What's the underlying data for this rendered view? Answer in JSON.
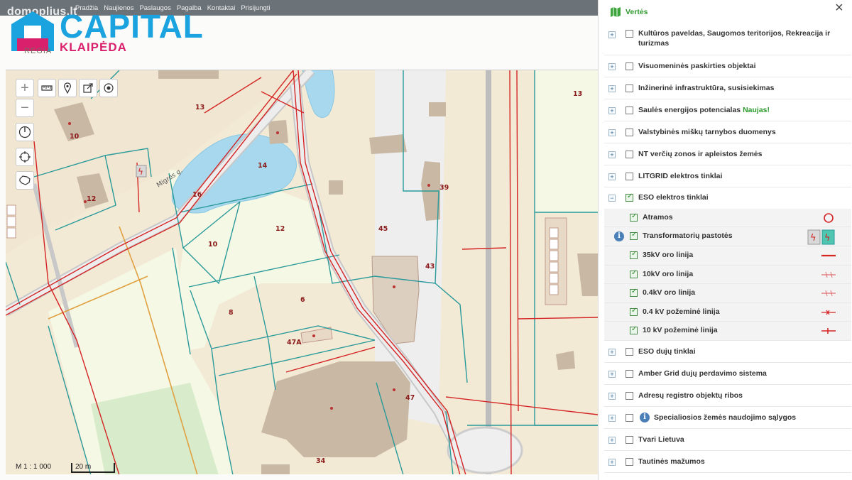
{
  "topnav": {
    "watermark": "domoplius.lt",
    "items": [
      "Pradžia",
      "Naujienos",
      "Paslaugos",
      "Pagalba",
      "Kontaktai",
      "Prisijungti"
    ]
  },
  "logo": {
    "brand": "CAPITAL",
    "city": "KLAIPĖDA",
    "sub": "REGIA"
  },
  "map": {
    "street_label": "Migros g.",
    "parcel_numbers": [
      "13",
      "10",
      "12",
      "14",
      "16",
      "12",
      "10",
      "8",
      "6",
      "47A",
      "45",
      "43",
      "39",
      "47",
      "34",
      "13"
    ],
    "scale_ratio": "M 1 : 1 000",
    "scale_bar": "20 m",
    "colors": {
      "parcel_line": "#2a9a9a",
      "power_line": "#d42424",
      "water": "#a8d8ee",
      "building": "#c9b8a4"
    }
  },
  "panel": {
    "title": "Vertės",
    "close": "×",
    "layers": [
      {
        "label": "Kultūros paveldas, Saugomos teritorijos, Rekreacija ir turizmas",
        "checked": false
      },
      {
        "label": "Visuomeninės paskirties objektai",
        "checked": false
      },
      {
        "label": "Inžinerinė infrastruktūra, susisiekimas",
        "checked": false
      },
      {
        "label": "Saulės energijos potencialas",
        "badge": "Naujas!",
        "checked": false
      },
      {
        "label": "Valstybinės miškų tarnybos duomenys",
        "checked": false
      },
      {
        "label": "NT verčių zonos ir apleistos žemės",
        "checked": false
      },
      {
        "label": "LITGRID elektros tinklai",
        "checked": false
      },
      {
        "label": "ESO elektros tinklai",
        "checked": true,
        "expanded": true,
        "children": [
          {
            "label": "Atramos",
            "checked": true,
            "legend": "circle-icon"
          },
          {
            "label": "Transformatorių pastotės",
            "checked": true,
            "legend": "substation-icon",
            "info": true
          },
          {
            "label": "35kV oro linija",
            "checked": true,
            "legend": "solid-line-icon"
          },
          {
            "label": "10kV oro linija",
            "checked": true,
            "legend": "tick-line-icon"
          },
          {
            "label": "0.4kV oro linija",
            "checked": true,
            "legend": "tick-line-icon"
          },
          {
            "label": "0.4 kV požeminė linija",
            "checked": true,
            "legend": "cross-line-icon"
          },
          {
            "label": "10 kV požeminė linija",
            "checked": true,
            "legend": "bar-line-icon"
          }
        ]
      },
      {
        "label": "ESO dujų tinklai",
        "checked": false
      },
      {
        "label": "Amber Grid dujų perdavimo sistema",
        "checked": false
      },
      {
        "label": "Adresų registro objektų ribos",
        "checked": false
      },
      {
        "label": "Specialiosios žemės naudojimo sąlygos",
        "checked": false,
        "info": true
      },
      {
        "label": "Tvari Lietuva",
        "checked": false
      },
      {
        "label": "Tautinės mažumos",
        "checked": false
      }
    ]
  }
}
